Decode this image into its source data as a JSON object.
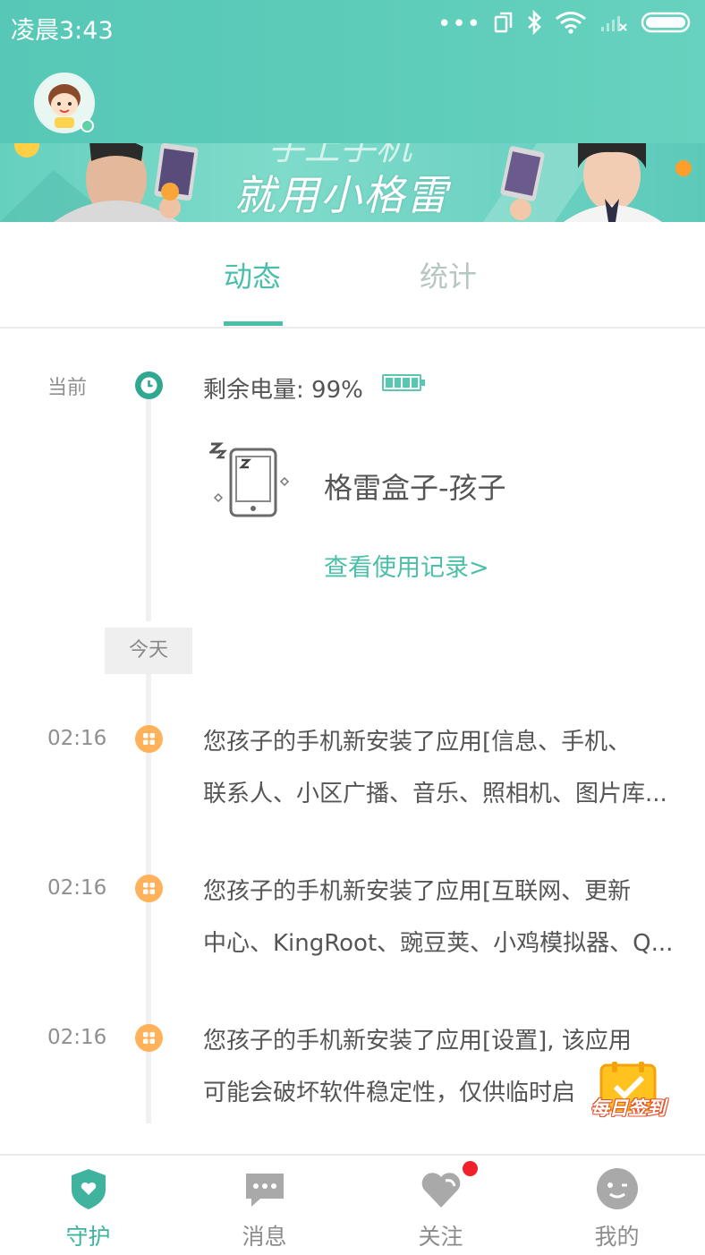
{
  "status_bar": {
    "time": "凌晨3:43",
    "dots": "•••"
  },
  "banner": {
    "slogan": "就用小格雷",
    "slogan_top": "手上手机"
  },
  "tabs": [
    {
      "label": "动态",
      "active": true
    },
    {
      "label": "统计",
      "active": false
    }
  ],
  "current": {
    "label": "当前",
    "battery_text": "剩余电量: 99%",
    "battery_level": 0.99
  },
  "device": {
    "name": "格雷盒子-孩子",
    "usage_link": "查看使用记录>"
  },
  "today_badge": "今天",
  "events": [
    {
      "time": "02:16",
      "line1": "您孩子的手机新安装了应用[信息、手机、",
      "line2": "联系人、小区广播、音乐、照相机、图片库..."
    },
    {
      "time": "02:16",
      "line1": "您孩子的手机新安装了应用[互联网、更新",
      "line2": "中心、KingRoot、豌豆荚、小鸡模拟器、Q..."
    },
    {
      "time": "02:16",
      "line1": "您孩子的手机新安装了应用[设置], 该应用",
      "line2": "可能会破坏软件稳定性，仅供临时启"
    }
  ],
  "daily_signin": "每日签到",
  "bottom_nav": [
    {
      "label": "守护",
      "icon": "shield-heart-icon",
      "active": true
    },
    {
      "label": "消息",
      "icon": "chat-bubble-icon",
      "active": false
    },
    {
      "label": "关注",
      "icon": "heart-icon",
      "active": false,
      "badge": true
    },
    {
      "label": "我的",
      "icon": "smiley-face-icon",
      "active": false
    }
  ],
  "colors": {
    "accent": "#4cbfa9",
    "header": "#5ecdb9",
    "event_dot": "#ffb25a",
    "clock_dot": "#30a88f",
    "notify": "#f0212b"
  }
}
